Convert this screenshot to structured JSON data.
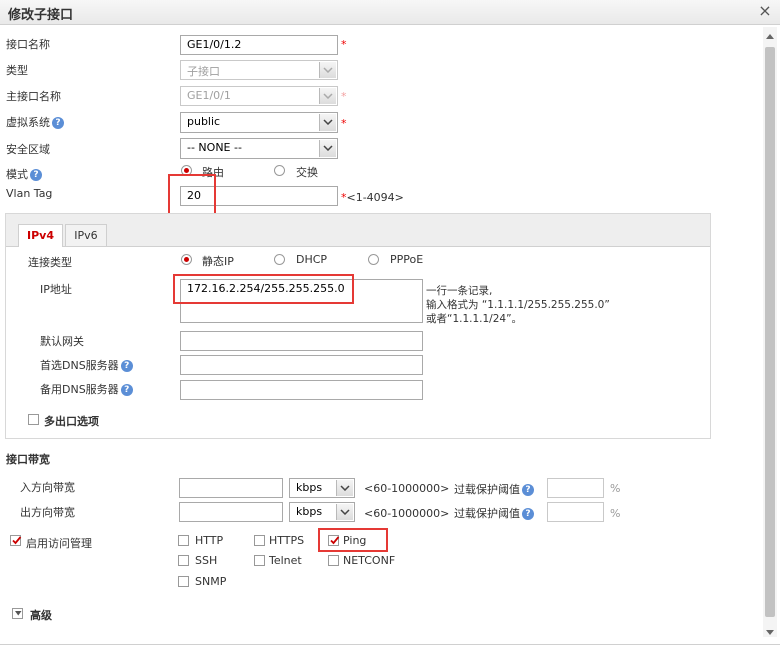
{
  "dialog": {
    "title": "修改子接口",
    "close_glyph": "×"
  },
  "form": {
    "iface_name_label": "接口名称",
    "iface_name_value": "GE1/0/1.2",
    "type_label": "类型",
    "type_value": "子接口",
    "main_iface_label": "主接口名称",
    "main_iface_value": "GE1/0/1",
    "vsys_label": "虚拟系统",
    "vsys_value": "public",
    "zone_label": "安全区域",
    "zone_value": "-- NONE --",
    "mode_label": "模式",
    "mode_routing": "路由",
    "mode_switch": "交换",
    "vlan_label": "Vlan Tag",
    "vlan_value": "20",
    "vlan_range": "<1-4094>",
    "required_mark": "*",
    "help_glyph": "?"
  },
  "tabs": [
    {
      "label": "IPv4",
      "active": true
    },
    {
      "label": "IPv6",
      "active": false
    }
  ],
  "ipv4": {
    "conn_type_label": "连接类型",
    "conn_static": "静态IP",
    "conn_dhcp": "DHCP",
    "conn_pppoe": "PPPoE",
    "ip_label": "IP地址",
    "ip_value": "172.16.2.254/255.255.255.0",
    "ip_hint_1": "一行一条记录,",
    "ip_hint_2": "输入格式为 “1.1.1.1/255.255.255.0”",
    "ip_hint_3": "或者“1.1.1.1/24”。",
    "gateway_label": "默认网关",
    "dns1_label": "首选DNS服务器",
    "dns2_label": "备用DNS服务器",
    "multi_exit_label": "多出口选项"
  },
  "bandwidth": {
    "section_label": "接口带宽",
    "in_label": "入方向带宽",
    "out_label": "出方向带宽",
    "unit": "kbps",
    "range": "<60-1000000>",
    "threshold_label": "过载保护阈值",
    "percent": "%"
  },
  "access": {
    "enable_label": "启用访问管理",
    "http": "HTTP",
    "https": "HTTPS",
    "ping": "Ping",
    "ssh": "SSH",
    "telnet": "Telnet",
    "netconf": "NETCONF",
    "snmp": "SNMP"
  },
  "advanced": {
    "label": "高级"
  },
  "colors": {
    "accent": "#cc0000",
    "highlight": "#e53935"
  }
}
